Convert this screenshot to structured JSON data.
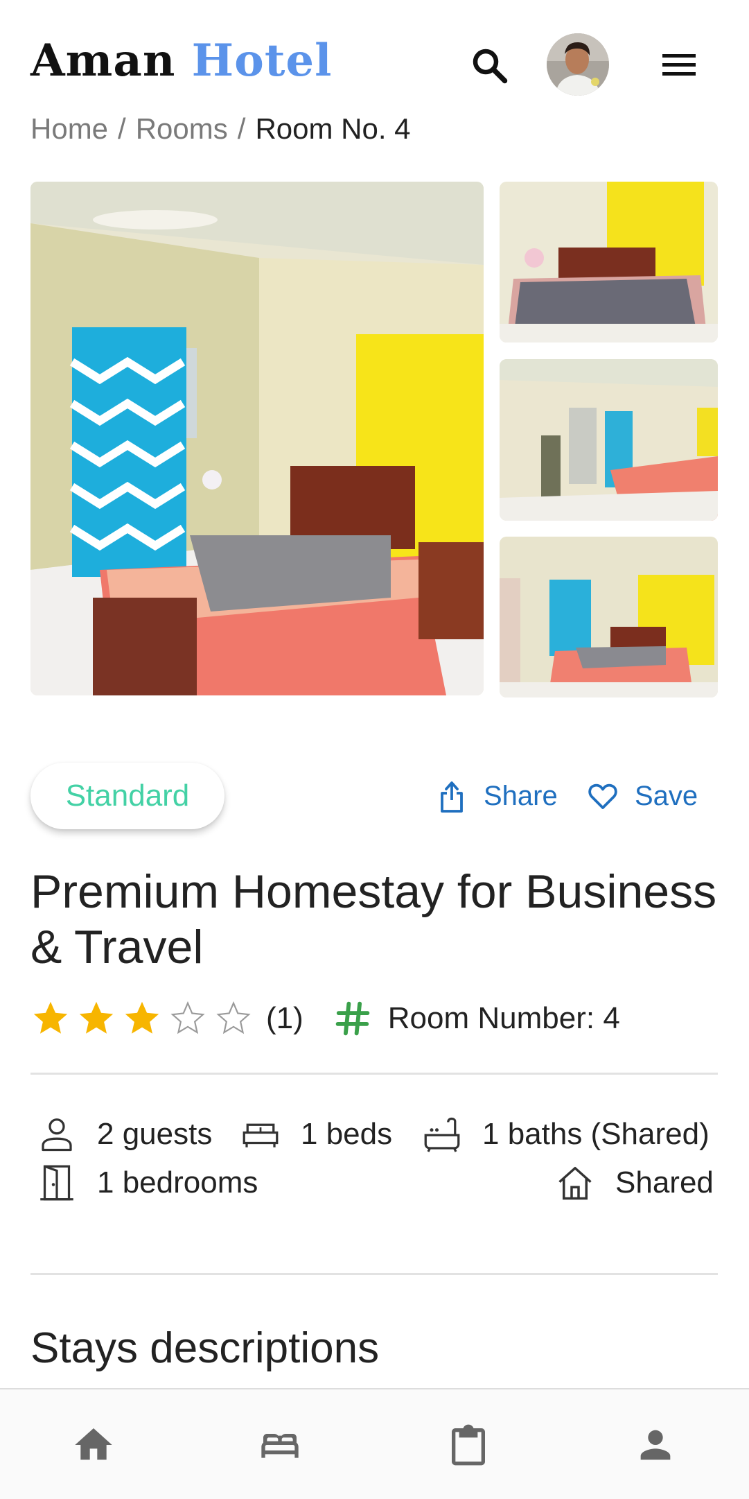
{
  "header": {
    "logo_part1": "Aman",
    "logo_part2": "Hotel",
    "logo_color_primary": "#111111",
    "logo_color_accent": "#5b93ea",
    "search_icon": "search-icon",
    "avatar": "user-avatar",
    "menu_icon": "hamburger-menu-icon"
  },
  "breadcrumb": {
    "items": [
      "Home",
      "Rooms",
      "Room No. 4"
    ],
    "separator": "/"
  },
  "gallery": {
    "main": "bedroom-photo-main",
    "thumbnails": [
      "bedroom-photo-2",
      "bedroom-photo-3",
      "bedroom-photo-4"
    ]
  },
  "room": {
    "category": "Standard",
    "category_color": "#43d1a5",
    "share_label": "Share",
    "save_label": "Save",
    "action_color": "#1f6fbf",
    "title": "Premium Homestay for Business & Travel",
    "rating": 3,
    "rating_max": 5,
    "star_color": "#f7b500",
    "review_count": "(1)",
    "room_number": "Room Number: 4",
    "hash_icon_color": "#3aa04a"
  },
  "features": {
    "guests": "2 guests",
    "beds": "1 beds",
    "baths": "1 baths (Shared)",
    "bedrooms": "1 bedrooms",
    "type": "Shared"
  },
  "sections": {
    "description_title": "Stays descriptions"
  },
  "bottom_nav": {
    "items": [
      "home-icon",
      "bed-icon",
      "clipboard-icon",
      "person-icon"
    ],
    "color": "#666666"
  }
}
